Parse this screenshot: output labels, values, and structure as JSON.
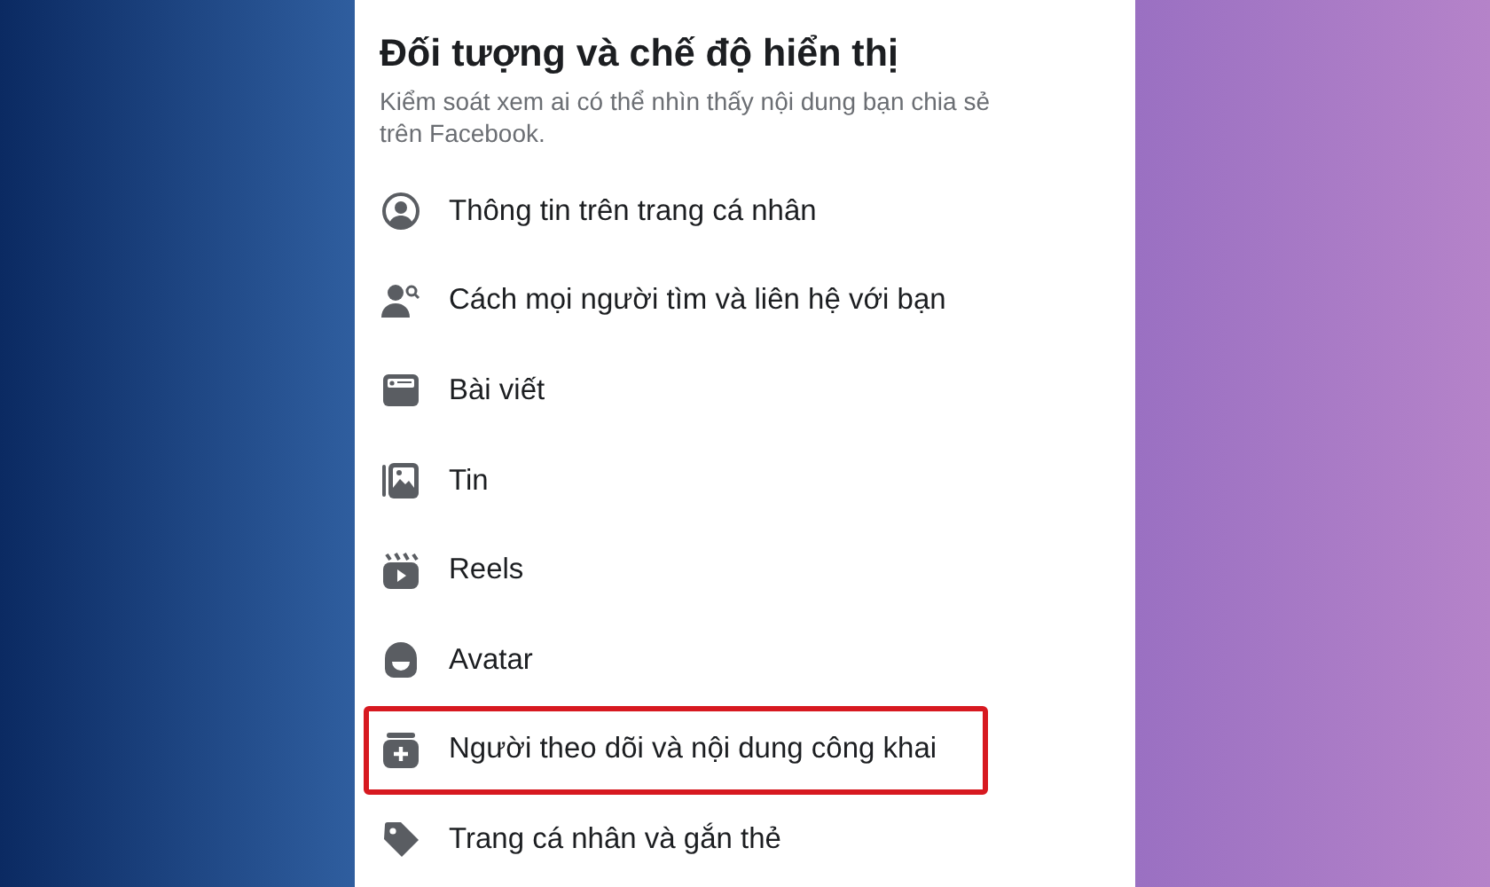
{
  "header": {
    "title": "Đối tượng và chế độ hiển thị",
    "subtitle": "Kiểm soát xem ai có thể nhìn thấy nội dung bạn chia sẻ trên Facebook."
  },
  "items": [
    {
      "label": "Thông tin trên trang cá nhân",
      "highlighted": false
    },
    {
      "label": "Cách mọi người tìm và liên hệ với bạn",
      "highlighted": false
    },
    {
      "label": "Bài viết",
      "highlighted": false
    },
    {
      "label": "Tin",
      "highlighted": false
    },
    {
      "label": "Reels",
      "highlighted": false
    },
    {
      "label": "Avatar",
      "highlighted": false
    },
    {
      "label": "Người theo dõi và nội dung công khai",
      "highlighted": true
    },
    {
      "label": "Trang cá nhân và gắn thẻ",
      "highlighted": false
    }
  ]
}
